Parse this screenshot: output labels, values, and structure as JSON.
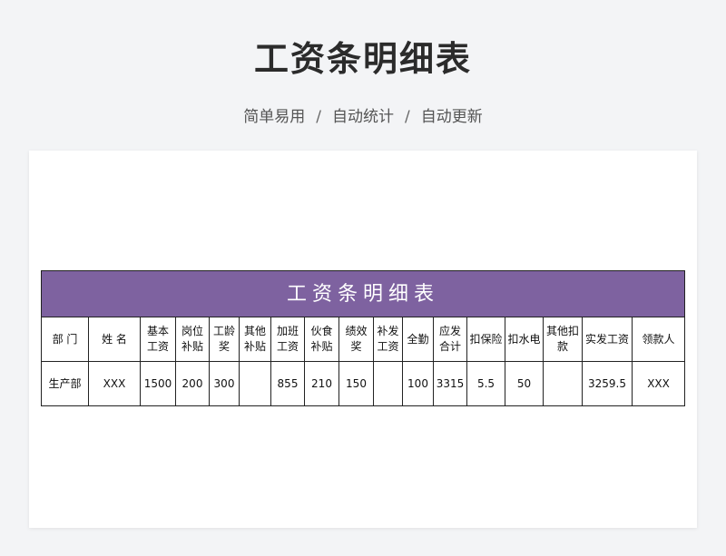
{
  "page": {
    "title": "工资条明细表",
    "tags": [
      "简单易用",
      "自动统计",
      "自动更新"
    ],
    "separator": "/"
  },
  "table": {
    "banner": "工资条明细表",
    "columns": [
      "部门",
      "姓名",
      "基本工资",
      "岗位补贴",
      "工龄奖",
      "其他补贴",
      "加班工资",
      "伙食补贴",
      "绩效奖",
      "补发工资",
      "全勤",
      "应发合计",
      "扣保险",
      "扣水电",
      "其他扣款",
      "实发工资",
      "领款人"
    ],
    "column_display": [
      "部 门",
      "姓 名",
      "基本\n工资",
      "岗位\n补贴",
      "工龄\n奖",
      "其他\n补贴",
      "加班\n工资",
      "伙食\n补贴",
      "绩效\n奖",
      "补发\n工资",
      "全勤",
      "应发\n合计",
      "扣保险",
      "扣水电",
      "其他扣\n款",
      "实发工资",
      "领款人"
    ],
    "rows": [
      [
        "生产部",
        "XXX",
        "1500",
        "200",
        "300",
        "",
        "855",
        "210",
        "150",
        "",
        "100",
        "3315",
        "5.5",
        "50",
        "",
        "3259.5",
        "XXX"
      ]
    ]
  }
}
